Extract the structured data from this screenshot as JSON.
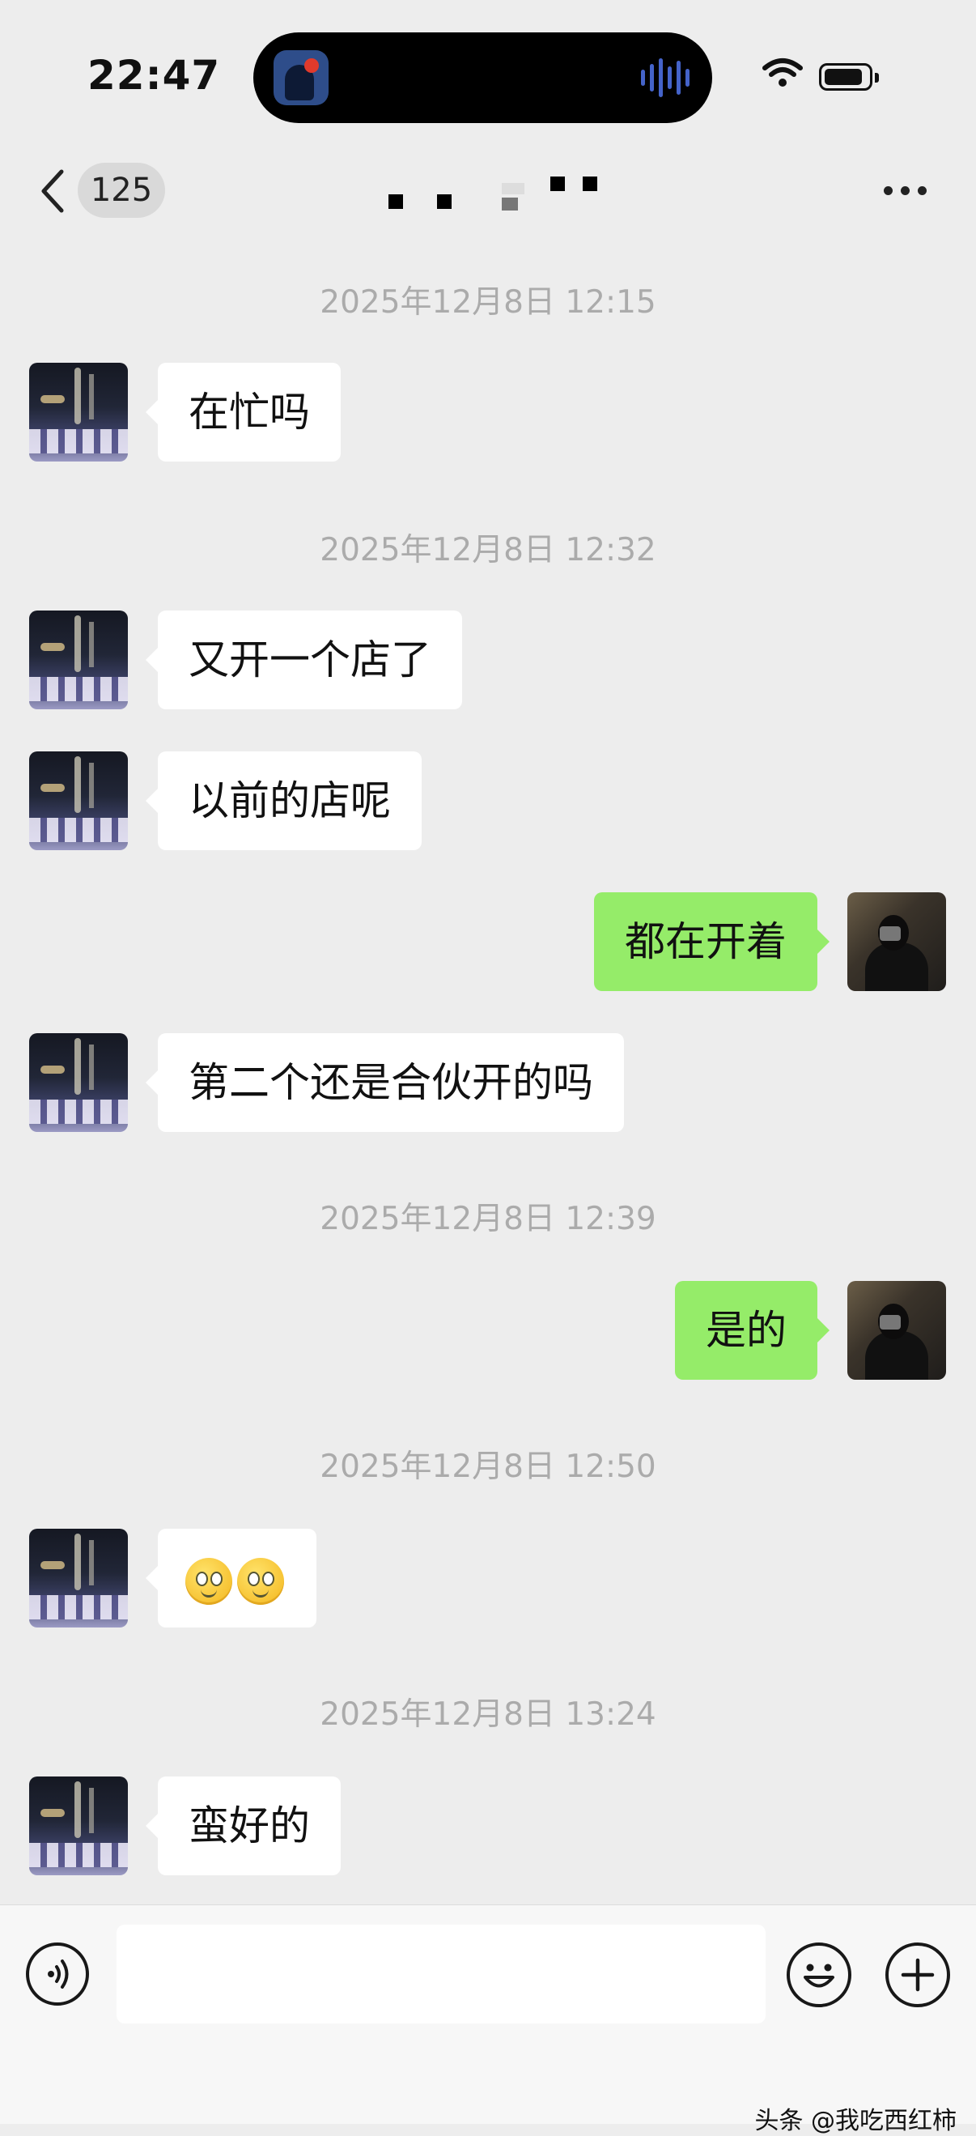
{
  "status_bar": {
    "time": "22:47"
  },
  "navbar": {
    "back_icon": "chevron-left-icon",
    "unread_count": "125",
    "more_icon": "more-horizontal-icon"
  },
  "messages": [
    {
      "type": "timestamp",
      "text": "2025年12月8日 12:15"
    },
    {
      "type": "message",
      "side": "left",
      "text": "在忙吗"
    },
    {
      "type": "timestamp",
      "text": "2025年12月8日 12:32"
    },
    {
      "type": "message",
      "side": "left",
      "text": "又开一个店了"
    },
    {
      "type": "message",
      "side": "left",
      "text": "以前的店呢"
    },
    {
      "type": "message",
      "side": "right",
      "text": "都在开着"
    },
    {
      "type": "message",
      "side": "left",
      "text": "第二个还是合伙开的吗"
    },
    {
      "type": "timestamp",
      "text": "2025年12月8日 12:39"
    },
    {
      "type": "message",
      "side": "right",
      "text": "是的"
    },
    {
      "type": "timestamp",
      "text": "2025年12月8日 12:50"
    },
    {
      "type": "message",
      "side": "left",
      "emoji": [
        "smile-emoji",
        "smile-emoji"
      ]
    },
    {
      "type": "timestamp",
      "text": "2025年12月8日 13:24"
    },
    {
      "type": "message",
      "side": "left",
      "text": "蛮好的"
    }
  ],
  "input_bar": {
    "voice_icon": "voice-icon",
    "emoji_icon": "emoji-icon",
    "plus_icon": "plus-icon",
    "input_value": ""
  },
  "watermark": "头条 @我吃西红柿",
  "colors": {
    "background": "#ededed",
    "sent_bubble": "#95ec69",
    "received_bubble": "#ffffff",
    "timestamp_text": "#ababab"
  }
}
